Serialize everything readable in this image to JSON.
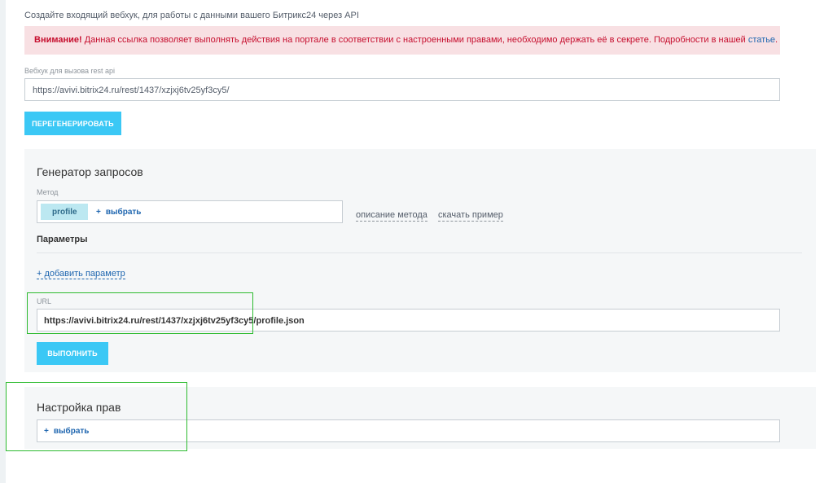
{
  "intro_text": "Создайте входящий вебхук, для работы с данными вашего Битрикс24 через API",
  "warning": {
    "bold": "Внимание!",
    "text": " Данная ссылка позволяет выполнять действия на портале в соответствии с настроенными правами, необходимо держать её в секрете. Подробности в нашей ",
    "link": "статье",
    "end": "."
  },
  "webhook": {
    "label": "Вебхук для вызова rest api",
    "value": "https://avivi.bitrix24.ru/rest/1437/xzjxj6tv25yf3cy5/",
    "regenerate_label": "ПЕРЕГЕНЕРИРОВАТЬ"
  },
  "generator": {
    "title": "Генератор запросов",
    "method_label": "Метод",
    "method_value": "profile",
    "select_label": "выбрать",
    "method_desc_link": "описание метода",
    "download_example_link": "скачать пример",
    "params_label": "Параметры",
    "add_param_label": "добавить параметр",
    "url_label": "URL",
    "url_value": "https://avivi.bitrix24.ru/rest/1437/xzjxj6tv25yf3cy5/profile.json",
    "execute_label": "ВЫПОЛНИТЬ"
  },
  "rights": {
    "title": "Настройка прав",
    "select_label": "выбрать"
  },
  "colors": {
    "accent": "#3bc8f5",
    "warning_bg": "#f8e0e3",
    "warning_text": "#c60e2e",
    "link": "#2067b0",
    "highlight_border": "#2dbb2f"
  }
}
